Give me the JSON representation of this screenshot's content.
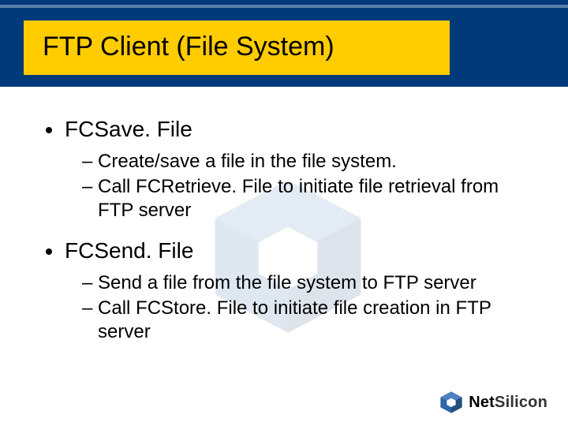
{
  "slide": {
    "title": "FTP Client (File System)",
    "items": [
      {
        "label": "FCSave. File",
        "subs": [
          "– Create/save a file in the file system.",
          "– Call FCRetrieve. File to initiate file retrieval from FTP server"
        ]
      },
      {
        "label": "FCSend. File",
        "subs": [
          "– Send a file from the file system to FTP server",
          "– Call FCStore. File to initiate file creation in FTP server"
        ]
      }
    ]
  },
  "branding": {
    "logo_mark_color": "#2f66a8",
    "logo_text_prefix": "Net",
    "logo_text_suffix": "Silicon"
  },
  "colors": {
    "header": "#003a7a",
    "title_bg": "#ffcc00"
  }
}
